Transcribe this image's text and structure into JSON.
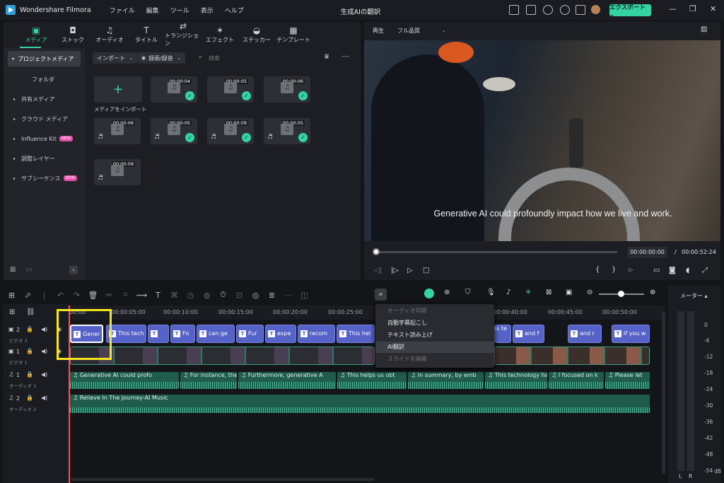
{
  "app": {
    "name": "Wondershare Filmora",
    "window_title": "生成AIの翻訳",
    "menu": [
      "ファイル",
      "編集",
      "ツール",
      "表示",
      "ヘルプ"
    ],
    "export_label": "エクスポート ⌄"
  },
  "tabs": [
    {
      "label": "メディア",
      "icon": "▣"
    },
    {
      "label": "ストック",
      "icon": "◘"
    },
    {
      "label": "オーディオ",
      "icon": "♫"
    },
    {
      "label": "タイトル",
      "icon": "T"
    },
    {
      "label": "トランジション",
      "icon": "⇄"
    },
    {
      "label": "エフェクト",
      "icon": "✶"
    },
    {
      "label": "ステッカー",
      "icon": "◒"
    },
    {
      "label": "テンプレート",
      "icon": "▦"
    }
  ],
  "sidebar": {
    "items": [
      {
        "label": "プロジェクトメディア",
        "selected": true
      },
      {
        "label": "フォルダ"
      },
      {
        "label": "共有メディア"
      },
      {
        "label": "クラウド メディア"
      },
      {
        "label": "Influence Kit",
        "badge": "NEW"
      },
      {
        "label": "調整レイヤー"
      },
      {
        "label": "サブシーケンス",
        "badge": "NEW"
      }
    ]
  },
  "media": {
    "import_dropdown": "インポート",
    "record_dropdown": "録画/録音",
    "search_placeholder": "検索",
    "import_label": "メディアをインポート",
    "thumbs": [
      {
        "dur": "00:00:04",
        "kind": "image"
      },
      {
        "dur": "00:00:05",
        "kind": "image"
      },
      {
        "dur": "00:00:06",
        "kind": "image"
      },
      {
        "dur": "00:00:06",
        "kind": "audio"
      },
      {
        "dur": "00:00:05",
        "kind": "audio"
      },
      {
        "dur": "00:00:09",
        "kind": "audio"
      },
      {
        "dur": "00:00:05",
        "kind": "audio"
      },
      {
        "dur": "00:00:09",
        "kind": "audio"
      }
    ]
  },
  "player": {
    "play_label": "再生",
    "quality": "フル品質",
    "subtitle": "Generative AI could profoundly impact how we live and work.",
    "current_time": "00:00:00:00",
    "separator": "/",
    "total_time": "00:00:52:24",
    "progress": 0.0
  },
  "timeline": {
    "ticks": [
      "00:00",
      "00:00:05:00",
      "00:00:10:00",
      "00:00:15:00",
      "00:00:20:00",
      "00:00:25:00",
      "00:00:40:00",
      "00:00:45:00",
      "00:00:50:00"
    ],
    "tracks": [
      {
        "num": "2",
        "name": "ビデオ 2"
      },
      {
        "num": "1",
        "name": "ビデオ 1"
      },
      {
        "num": "1",
        "name": "オーディオ 1"
      },
      {
        "num": "2",
        "name": "オーディオ 2"
      }
    ],
    "title_clips": [
      "Gener",
      "This tech",
      "",
      "Fo",
      "can ge",
      "Fur",
      "expe",
      "recom",
      "This hel",
      "is te",
      "and f",
      "and r",
      "if you w"
    ],
    "audio1_clips": [
      "Generative AI could profo",
      "For instance, the",
      "Furthermore, generative A",
      "This helps us obt",
      "In summary, by emb",
      "This technology has",
      "I focused on k",
      "Please let"
    ],
    "audio2_clip": "Relieve In The Journey-AI Music"
  },
  "popup": {
    "items": [
      {
        "label": "オーディオ同期",
        "disabled": true
      },
      {
        "label": "自動字幕起こし"
      },
      {
        "label": "テキスト読み上げ"
      },
      {
        "label": "AI翻訳",
        "highlighted": true
      },
      {
        "label": "スライドを編集",
        "disabled": true
      }
    ]
  },
  "meter": {
    "label": "メーター ▴",
    "db": [
      "0",
      "-6",
      "-12",
      "-18",
      "-24",
      "-30",
      "-36",
      "-42",
      "-48",
      "-54",
      "dB"
    ],
    "lr": [
      "L",
      "R"
    ]
  },
  "colors": {
    "accent": "#35d3a4",
    "title_clip": "#5563c8",
    "highlight_box": "#f5e71b",
    "playhead": "#ff4d57"
  }
}
